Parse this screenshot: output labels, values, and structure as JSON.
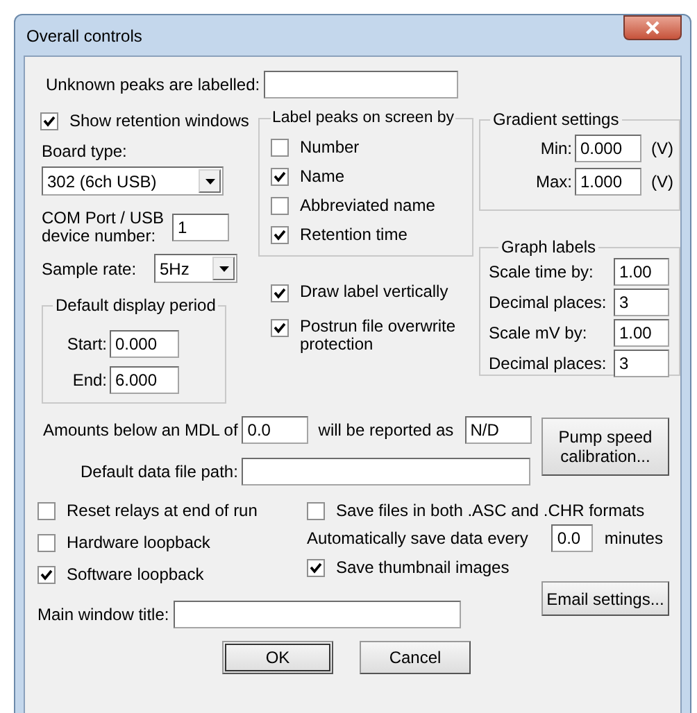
{
  "window": {
    "title": "Overall controls"
  },
  "unknown_peaks": {
    "label": "Unknown peaks are labelled:"
  },
  "show_retention_windows": {
    "label": "Show retention windows",
    "checked": true
  },
  "board_type": {
    "label": "Board type:",
    "value": "302 (6ch USB)"
  },
  "device_number": {
    "label": "COM Port / USB device number:",
    "value": "1"
  },
  "sample_rate": {
    "label": "Sample rate:",
    "value": "5Hz"
  },
  "display_period": {
    "title": "Default display period",
    "fields": [
      {
        "label": "Start:",
        "value": "0.000"
      },
      {
        "label": "End:",
        "value": "6.000"
      }
    ]
  },
  "label_peaks": {
    "title": "Label peaks on screen by",
    "options": [
      {
        "label": "Number",
        "checked": false
      },
      {
        "label": "Name",
        "checked": true
      },
      {
        "label": "Abbreviated name",
        "checked": false
      },
      {
        "label": "Retention time",
        "checked": true
      }
    ]
  },
  "draw_options": [
    {
      "label": "Draw label vertically",
      "checked": true
    },
    {
      "label": "Postrun file overwrite protection",
      "checked": true
    }
  ],
  "gradient": {
    "title": "Gradient settings",
    "fields": [
      {
        "label": "Min:",
        "value": "0.000",
        "unit": "(V)"
      },
      {
        "label": "Max:",
        "value": "1.000",
        "unit": "(V)"
      }
    ]
  },
  "graph_labels": {
    "title": "Graph labels",
    "fields": [
      {
        "label": "Scale time by:",
        "value": "1.00"
      },
      {
        "label": "Decimal places:",
        "value": "3"
      },
      {
        "label": "Scale mV by:",
        "value": "1.00"
      },
      {
        "label": "Decimal places:",
        "value": "3"
      }
    ]
  },
  "mdl": {
    "label": "Amounts below an MDL of",
    "value": "0.0",
    "reported_label": "will be reported as",
    "reported_value": "N/D"
  },
  "pump_button": "Pump speed calibration...",
  "data_path": {
    "label": "Default data file path:"
  },
  "left_checks": [
    {
      "label": "Reset relays at end of run",
      "checked": false
    },
    {
      "label": "Hardware loopback",
      "checked": false
    },
    {
      "label": "Software loopback",
      "checked": true
    }
  ],
  "save_both": {
    "label": "Save files in both .ASC and .CHR formats",
    "checked": false
  },
  "autosave": {
    "label": "Automatically save data every",
    "value": "0.0",
    "unit": "minutes"
  },
  "thumbnails": {
    "label": "Save thumbnail images",
    "checked": true
  },
  "email_button": "Email settings...",
  "main_title": {
    "label": "Main window title:"
  },
  "buttons": [
    "OK",
    "Cancel"
  ]
}
